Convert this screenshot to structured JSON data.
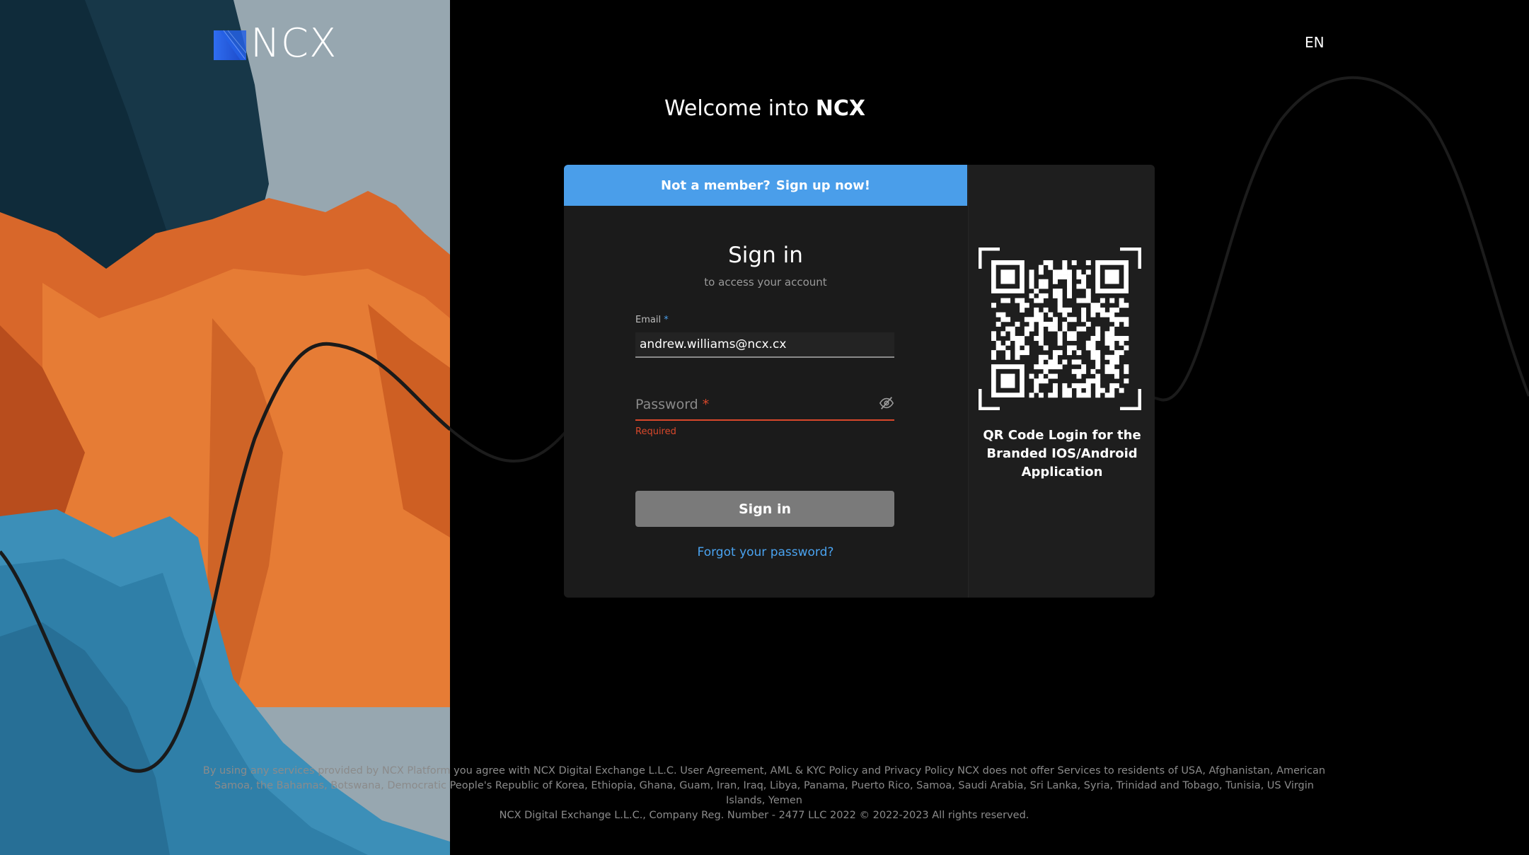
{
  "brand": {
    "name": "NCX"
  },
  "language": {
    "label": "EN"
  },
  "welcome": {
    "prefix": "Welcome into",
    "brand": "NCX"
  },
  "signup": {
    "question": "Not a member?",
    "link": "Sign up now!"
  },
  "signin": {
    "title": "Sign in",
    "subtitle": "to access your account",
    "email_label": "Email",
    "email_value": "andrew.williams@ncx.cx",
    "password_placeholder": "Password",
    "required_marker": "*",
    "password_error": "Required",
    "button": "Sign in",
    "forgot": "Forgot your password?"
  },
  "qr": {
    "caption": "QR Code Login for the Branded IOS/Android Application"
  },
  "footer": {
    "disclaimer": "By using any services provided by NCX Platform you agree with NCX Digital Exchange L.L.C. User Agreement, AML & KYC Policy and Privacy Policy NCX does not offer Services to residents of USA, Afghanistan, American Samoa, the Bahamas, Botswana, Democratic People's Republic of Korea, Ethiopia, Ghana, Guam, Iran, Iraq, Libya, Panama, Puerto Rico, Samoa, Saudi Arabia, Sri Lanka, Syria, Trinidad and Tobago, Tunisia, US Virgin Islands, Yemen",
    "copyright": "NCX Digital Exchange L.L.C., Company Reg. Number - 2477 LLC 2022 © 2022-2023 All rights reserved."
  },
  "colors": {
    "accent": "#4a9eea",
    "error": "#d9482b",
    "card_bg": "#1b1b1b",
    "page_bg": "#000000",
    "button_disabled": "#7a7a7a"
  },
  "icons": {
    "password_toggle": "eye-slash-icon",
    "logo": "ncx-logo-mark"
  }
}
